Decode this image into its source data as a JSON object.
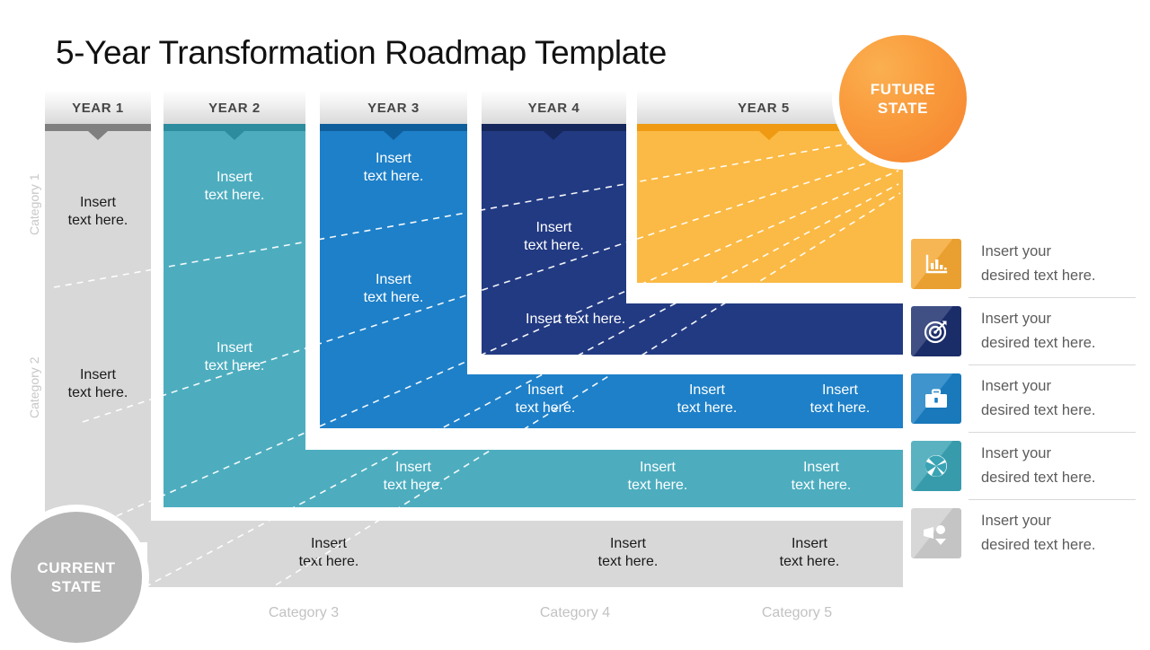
{
  "title": "5-Year Transformation Roadmap Template",
  "cell_text": "Insert\ntext here.",
  "colors": {
    "gray": "#d8d8d8",
    "gray_bar": "#808080",
    "teal": "#4dadbf",
    "teal_bar": "#2d8c9e",
    "blue": "#1e80c8",
    "blue_bar": "#0f5e9c",
    "navy": "#223a82",
    "navy_bar": "#16275c",
    "orange": "#fbba45",
    "orange_bar": "#ef9a12",
    "future_circle": "#f79434",
    "current_circle": "#b6b6b6"
  },
  "years": [
    {
      "label": "YEAR 1"
    },
    {
      "label": "YEAR 2"
    },
    {
      "label": "YEAR 3"
    },
    {
      "label": "YEAR 4"
    },
    {
      "label": "YEAR 5"
    }
  ],
  "side_categories": [
    {
      "label": "Category 1"
    },
    {
      "label": "Category 2"
    }
  ],
  "bottom_categories": [
    {
      "label": "Category 3"
    },
    {
      "label": "Category 4"
    },
    {
      "label": "Category 5"
    }
  ],
  "future_state": {
    "line1": "FUTURE",
    "line2": "STATE"
  },
  "current_state": {
    "line1": "CURRENT",
    "line2": "STATE"
  },
  "blocks": {
    "gray_col": {
      "c1": "Insert\ntext here.",
      "c2": "Insert\ntext here."
    },
    "teal_col": {
      "c1": "Insert\ntext here.",
      "c2": "Insert\ntext here."
    },
    "blue_col": {
      "c1": "Insert\ntext here.",
      "c2": "Insert\ntext here."
    },
    "navy_col": {
      "c1": "Insert\ntext here."
    },
    "navy_row": {
      "c1": "Insert\ntext here."
    },
    "blue_row": {
      "c1": "Insert\ntext here.",
      "c2": "Insert\ntext here.",
      "c3": "Insert\ntext here."
    },
    "teal_row": {
      "c1": "Insert\ntext here.",
      "c2": "Insert\ntext here.",
      "c3": "Insert\ntext here."
    },
    "gray_row": {
      "c1": "Insert\ntext here.",
      "c2": "Insert\ntext here.",
      "c3": "Insert\ntext here."
    }
  },
  "legend": [
    {
      "icon": "bar-chart-icon",
      "color": "#f5a833",
      "text": "Insert your\ndesired text here."
    },
    {
      "icon": "target-icon",
      "color": "#1c2f6e",
      "text": "Insert your\ndesired text here."
    },
    {
      "icon": "briefcase-icon",
      "color": "#1a7fc4",
      "text": "Insert your\ndesired text here."
    },
    {
      "icon": "aperture-icon",
      "color": "#3aa3b4",
      "text": "Insert your\ndesired text here."
    },
    {
      "icon": "presentation-icon",
      "color": "#cfcfcf",
      "text": "Insert your\ndesired text here."
    }
  ]
}
